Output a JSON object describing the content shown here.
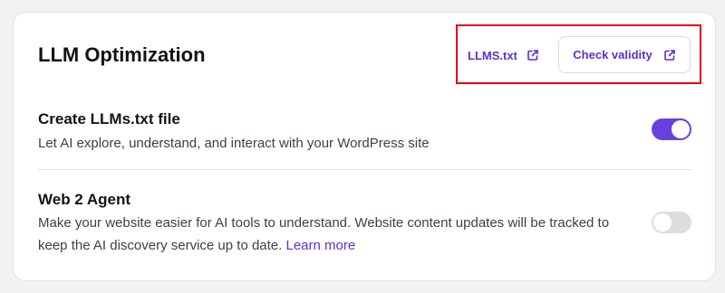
{
  "section": {
    "title": "LLM Optimization",
    "llms_link_label": "LLMS.txt",
    "check_validity_label": "Check validity"
  },
  "settings": [
    {
      "title": "Create LLMs.txt file",
      "description": "Let AI explore, understand, and interact with your WordPress site",
      "enabled": true
    },
    {
      "title": "Web 2 Agent",
      "description_line1": "Make your website easier for AI tools to understand. Website content updates will be tracked to",
      "description_line2": "keep the AI discovery service up to date.",
      "learn_more_label": "Learn more",
      "enabled": false
    }
  ],
  "icons": {
    "llms_link": "external-link-icon",
    "check_validity": "external-link-icon"
  },
  "colors": {
    "accent": "#5b2fd0",
    "toggle_on": "#6a3fe0",
    "toggle_off": "#dcdde1",
    "highlight_box": "#e3000b"
  }
}
